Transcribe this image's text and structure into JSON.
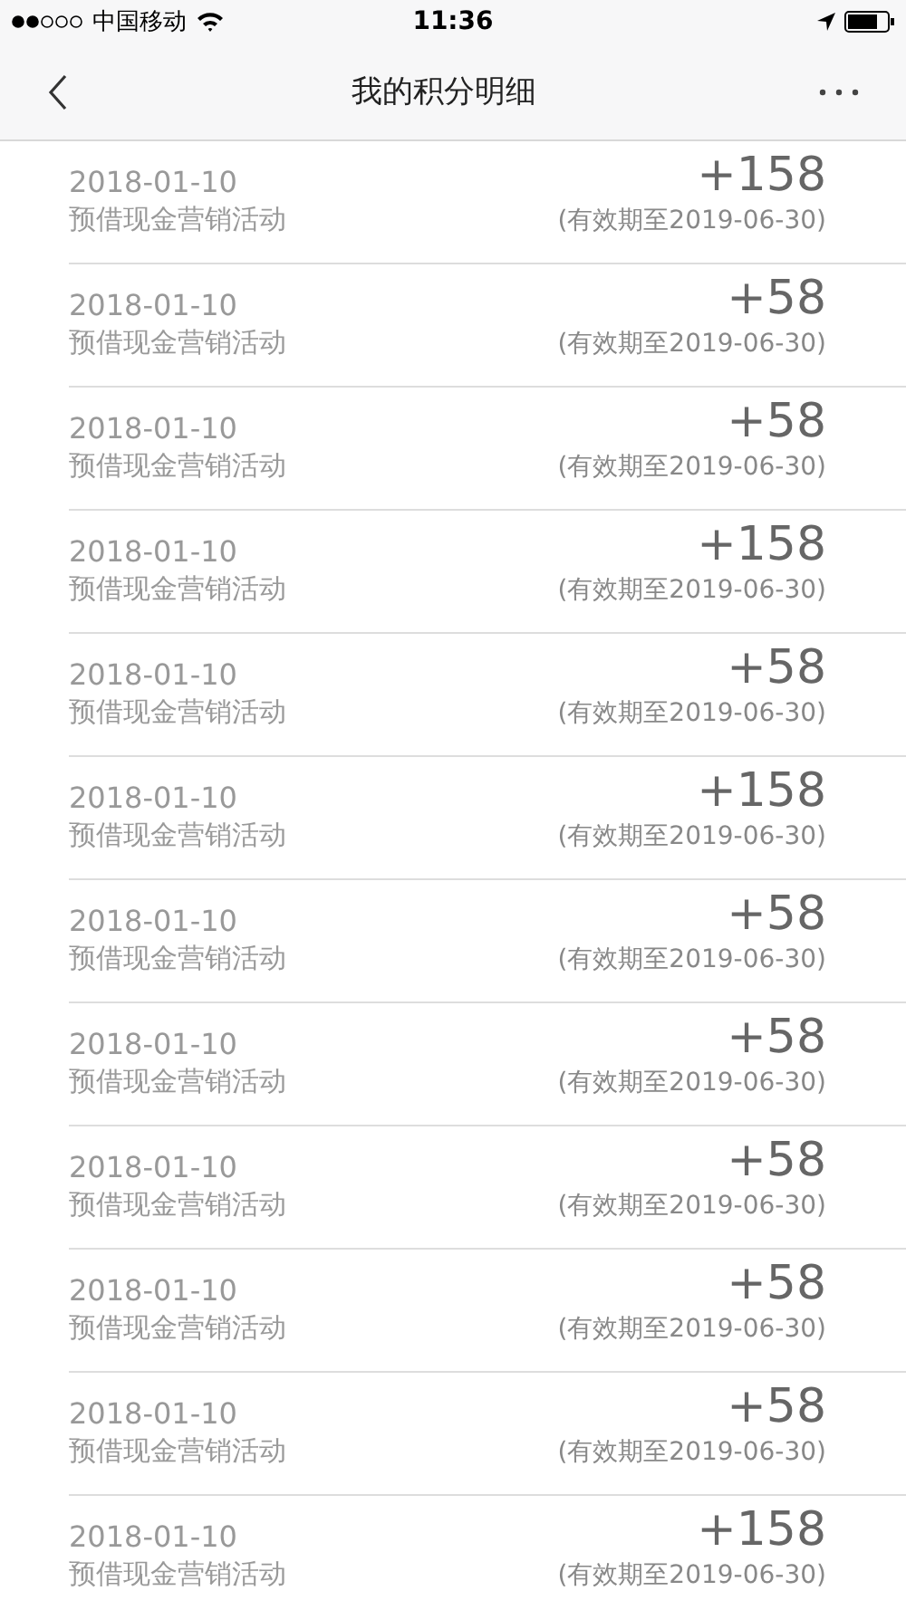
{
  "status_bar": {
    "carrier": "中国移动",
    "time": "11:36"
  },
  "nav": {
    "title": "我的积分明细"
  },
  "records": [
    {
      "date": "2018-01-10",
      "source": "预借现金营销活动",
      "points": "+158",
      "expiry": "(有效期至2019-06-30)"
    },
    {
      "date": "2018-01-10",
      "source": "预借现金营销活动",
      "points": "+58",
      "expiry": "(有效期至2019-06-30)"
    },
    {
      "date": "2018-01-10",
      "source": "预借现金营销活动",
      "points": "+58",
      "expiry": "(有效期至2019-06-30)"
    },
    {
      "date": "2018-01-10",
      "source": "预借现金营销活动",
      "points": "+158",
      "expiry": "(有效期至2019-06-30)"
    },
    {
      "date": "2018-01-10",
      "source": "预借现金营销活动",
      "points": "+58",
      "expiry": "(有效期至2019-06-30)"
    },
    {
      "date": "2018-01-10",
      "source": "预借现金营销活动",
      "points": "+158",
      "expiry": "(有效期至2019-06-30)"
    },
    {
      "date": "2018-01-10",
      "source": "预借现金营销活动",
      "points": "+58",
      "expiry": "(有效期至2019-06-30)"
    },
    {
      "date": "2018-01-10",
      "source": "预借现金营销活动",
      "points": "+58",
      "expiry": "(有效期至2019-06-30)"
    },
    {
      "date": "2018-01-10",
      "source": "预借现金营销活动",
      "points": "+58",
      "expiry": "(有效期至2019-06-30)"
    },
    {
      "date": "2018-01-10",
      "source": "预借现金营销活动",
      "points": "+58",
      "expiry": "(有效期至2019-06-30)"
    },
    {
      "date": "2018-01-10",
      "source": "预借现金营销活动",
      "points": "+58",
      "expiry": "(有效期至2019-06-30)"
    },
    {
      "date": "2018-01-10",
      "source": "预借现金营销活动",
      "points": "+158",
      "expiry": "(有效期至2019-06-30)"
    }
  ]
}
